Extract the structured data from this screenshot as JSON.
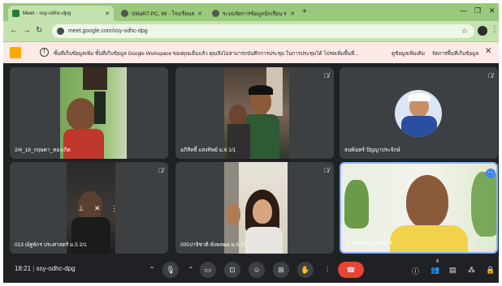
{
  "browser": {
    "tabs": [
      {
        "title": "Meet - ssy-odhc-dpg",
        "active": true,
        "color": "#188038"
      },
      {
        "title": "SMaRT-PC, IM - โรงเรียนสตรี...",
        "active": false,
        "color": "#555555"
      },
      {
        "title": "ระบบจัดการข้อมูลนักเรียน ระดับ...",
        "active": false,
        "color": "#555555"
      }
    ],
    "url": "meet.google.com/ssy-odhc-dpg"
  },
  "banner": {
    "text": "ขั้นที่เก็บข้อมูลเพิ่ม ขั้นที่เก็บข้อมูล Google Workspace ของคุณเต็มแล้ว คุณจึงไม่สามารถบันทึกการประชุม ในการประชุมได้ โปรดเพิ่มพื้นที่...",
    "link1": "ดูข้อมูลเพิ่มเติม",
    "link2": "จัดการพื้นที่เก็บข้อมูล"
  },
  "participants": [
    {
      "name": "2/4_18_กฤษดา_ทองเกิด",
      "muted": false
    },
    {
      "name": "อภิสิทธิ์ แสงทิพย์ ม.6 1/1",
      "muted": true
    },
    {
      "name": "ธนพินทร์ ปัญญาประจักษ์",
      "muted": true
    },
    {
      "name": "013 ณัฐพักร ประศาสตร์ ม.5 2/1",
      "muted": true
    },
    {
      "name": "005ปาจิชาติ ทั่งพลพม ม.5 2/1",
      "muted": true
    },
    {
      "name": "นายเนวิศ คุณยาสาร",
      "muted": false
    }
  ],
  "meeting": {
    "time": "18:21",
    "code": "ssy-odhc-dpg"
  },
  "participant_count": "6",
  "colors": {
    "accent": "#8ab4f8",
    "end_call": "#ea4335",
    "tab_strip": "#9ac87c"
  }
}
